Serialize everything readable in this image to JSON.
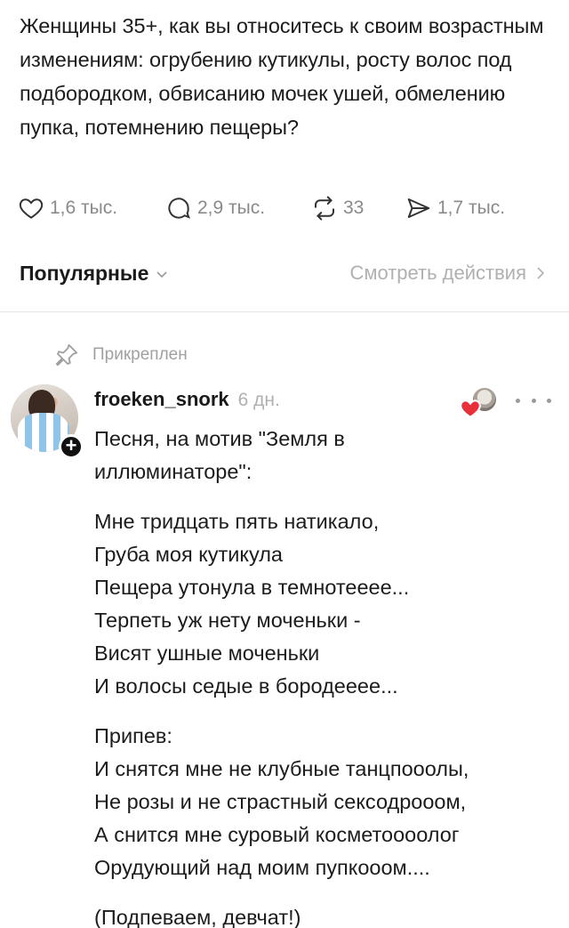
{
  "post": {
    "text": "Женщины 35+, как вы относитесь к своим возрастным изменениям: огрубению кутикулы, росту волос под подбородком, обвисанию мочек ушей, обмелению пупка, потемнению пещеры?"
  },
  "actions": {
    "likes": "1,6 тыс.",
    "replies": "2,9 тыс.",
    "reposts": "33",
    "shares": "1,7 тыс."
  },
  "sort": {
    "label": "Популярные",
    "view_activity": "Смотреть действия"
  },
  "pinned": {
    "label": "Прикреплен"
  },
  "comment": {
    "username": "froeken_snork",
    "time": "6 дн.",
    "lines": {
      "intro1": "Песня, на мотив \"Земля в",
      "intro2": "иллюминаторе\":",
      "v1": "Мне тридцать пять натикало,",
      "v2": "Груба моя кутикула",
      "v3": "Пещера утонула в темнотееее...",
      "v4": "Терпеть уж нету моченьки -",
      "v5": "Висят ушные моченьки",
      "v6": "И волосы седые в бородееее...",
      "c0": "Припев:",
      "c1": "И снятся мне не клубные танцпооолы,",
      "c2": "Не розы и не страстный сексодрооом,",
      "c3": "А снится мне суровый косметооoолог",
      "c4": "Орудующий над моим пупкооом....",
      "outro": "(Подпеваем, девчат!)"
    }
  },
  "colors": {
    "text": "#1c1c1c",
    "muted": "#8a8a8a",
    "heart": "#e8303a"
  },
  "icons": [
    "heart-icon",
    "comment-icon",
    "repost-icon",
    "share-icon",
    "chevron-down-icon",
    "chevron-right-icon",
    "pin-icon",
    "plus-icon",
    "more-icon"
  ]
}
